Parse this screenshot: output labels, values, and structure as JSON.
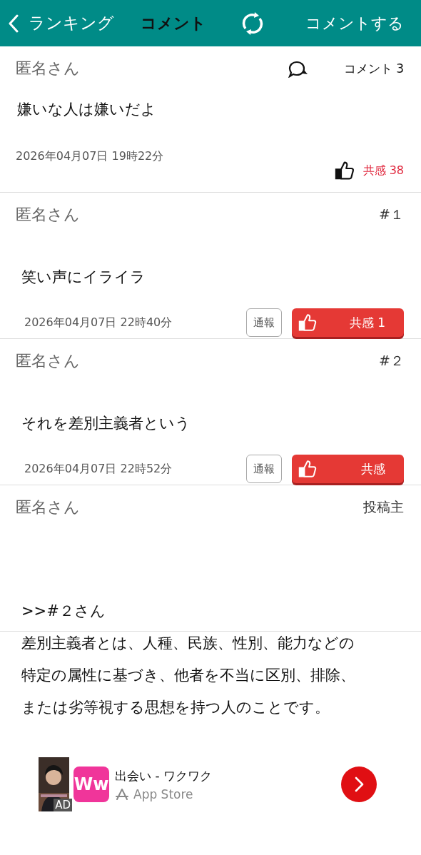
{
  "header": {
    "back_label": "ランキング",
    "title": "コメント",
    "action_label": "コメントする"
  },
  "post": {
    "author": "匿名さん",
    "comment_count": "コメント 3",
    "body": "嫌いな人は嫌いだよ",
    "date": "2026年04月07日 19時22分",
    "like_label": "共感",
    "like_count": "38"
  },
  "comments": [
    {
      "author": "匿名さん",
      "number": "#１",
      "body_lines": [
        "笑い声にイライラ"
      ],
      "date": "2026年04月07日 22時40分",
      "report_label": "通報",
      "like_label": "共感",
      "like_count": "1"
    },
    {
      "author": "匿名さん",
      "number": "#２",
      "body_lines": [
        "それを差別主義者という"
      ],
      "date": "2026年04月07日 22時52分",
      "report_label": "通報",
      "like_label": "共感"
    },
    {
      "author": "匿名さん",
      "number": "投稿主",
      "body_lines": [
        ">>#２さん",
        "差別主義者とは、人種、民族、性別、能力などの",
        "特定の属性に基づき、他者を不当に区別、排除、",
        "または劣等視する思想を持つ人のことです。"
      ]
    }
  ],
  "ad": {
    "badge": "AD",
    "app_icon_text": "Ww",
    "title": "出会い - ワクワク",
    "store": "App Store"
  }
}
